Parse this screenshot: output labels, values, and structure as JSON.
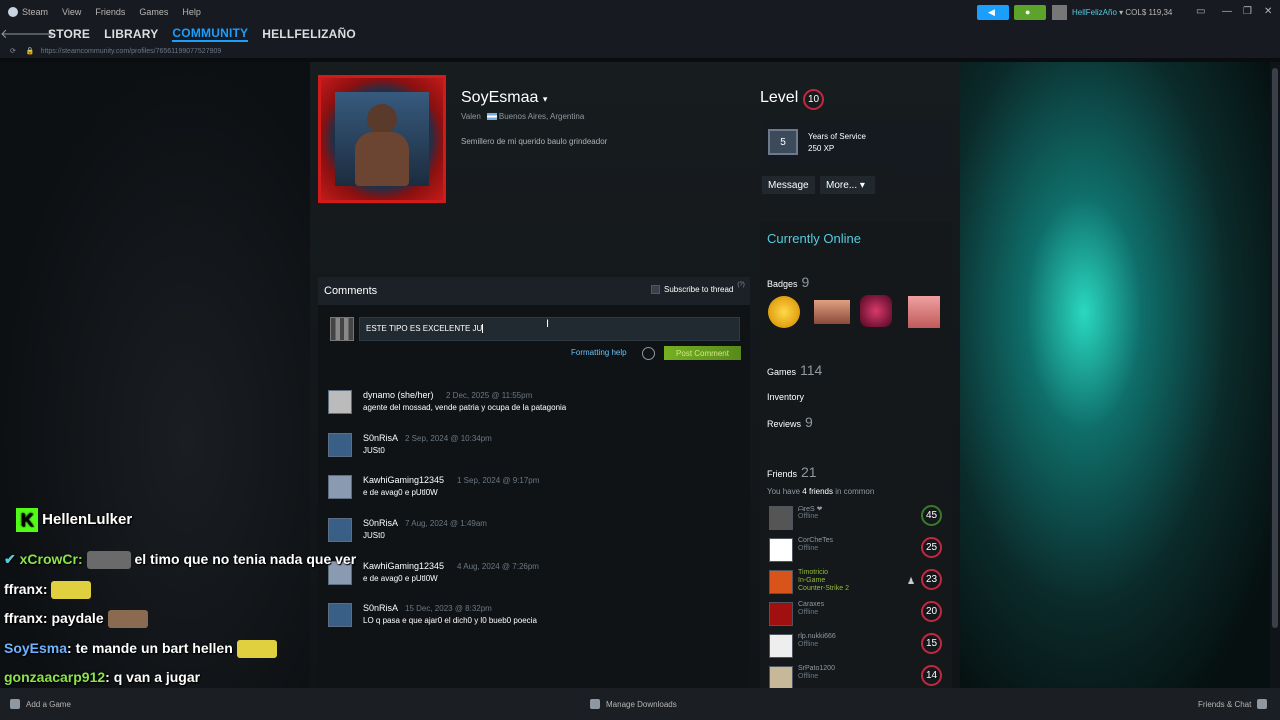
{
  "menu": {
    "app": "Steam",
    "items": [
      "View",
      "Friends",
      "Games",
      "Help"
    ]
  },
  "nav": {
    "store": "STORE",
    "library": "LIBRARY",
    "community": "COMMUNITY",
    "user": "HELLFELIZAÑO"
  },
  "url": "https://steamcommunity.com/profiles/76561199077527909",
  "account": {
    "name": "HellFelizAño",
    "balance": "COL$ 119,34"
  },
  "profile": {
    "persona": "SoyEsmaa",
    "real_name": "Valen",
    "location": "Buenos Aires, Argentina",
    "summary": "Semillero de mi querido baulo grindeador"
  },
  "level": {
    "label": "Level",
    "value": "10"
  },
  "years_service": {
    "years": "5",
    "title": "Years of Service",
    "xp": "250 XP"
  },
  "buttons": {
    "message": "Message",
    "more": "More... ▾"
  },
  "status": "Currently Online",
  "badges": {
    "label": "Badges",
    "count": "9"
  },
  "games": {
    "label": "Games",
    "count": "114"
  },
  "inventory": "Inventory",
  "reviews": {
    "label": "Reviews",
    "count": "9"
  },
  "friends": {
    "label": "Friends",
    "count": "21",
    "common_pre": "You have ",
    "common_count": "4 friends",
    "common_post": " in common",
    "list": [
      {
        "name": "ᗩreS ❤",
        "status": "Offline",
        "level": "45",
        "color": "#3a7a2a"
      },
      {
        "name": "CorCheTes",
        "status": "Offline",
        "level": "25",
        "color": "#c02942"
      },
      {
        "name": "Timotricio",
        "status": "In-Game",
        "game": "Counter-Strike 2",
        "level": "23",
        "color": "#c02942"
      },
      {
        "name": "Caraxes",
        "status": "Offline",
        "level": "20",
        "color": "#c02942"
      },
      {
        "name": "rlp.nukki666",
        "status": "Offline",
        "level": "15",
        "color": "#c02942"
      },
      {
        "name": "SrPato1200",
        "status": "Offline",
        "level": "14",
        "color": "#c02942"
      }
    ]
  },
  "comments": {
    "title": "Comments",
    "subscribe": "Subscribe to thread",
    "help_mark": "(?)",
    "input_value": "ESTE TIPO ES EXCELENTE JU",
    "formatting_help": "Formatting help",
    "post_button": "Post Comment",
    "list": [
      {
        "author": "dynamo (she/her)",
        "date": "2 Dec, 2025 @ 11:55pm",
        "text": "agente del mossad, vende patria y ocupa de la patagonia"
      },
      {
        "author": "S0nRisA",
        "date": "2 Sep, 2024 @ 10:34pm",
        "text": "JUSt0"
      },
      {
        "author": "KawhiGaming12345",
        "date": "1 Sep, 2024 @ 9:17pm",
        "text": "e de avag0 e pUtl0W"
      },
      {
        "author": "S0nRisA",
        "date": "7 Aug, 2024 @ 1:49am",
        "text": "JUSt0"
      },
      {
        "author": "KawhiGaming12345",
        "date": "4 Aug, 2024 @ 7:26pm",
        "text": "e de avag0 e pUtl0W"
      },
      {
        "author": "S0nRisA",
        "date": "15 Dec, 2023 @ 8:32pm",
        "text": "LO q pasa e que ajar0 el dich0 y l0 bueb0 poecia"
      }
    ]
  },
  "chat": {
    "header": "HellenLulker",
    "lines": [
      {
        "user": "xCrowCr",
        "text": "el timo que no tenia nada que ver"
      },
      {
        "user": "ffranx",
        "text": ""
      },
      {
        "user": "ffranx",
        "text": "paydale"
      },
      {
        "user": "SoyEsma",
        "text": "te mande un bart hellen"
      },
      {
        "user": "gonzaacarp912",
        "text": "q van a jugar"
      }
    ]
  },
  "footer": {
    "add_game": "Add a Game",
    "downloads": "Manage Downloads",
    "friends_chat": "Friends & Chat"
  }
}
